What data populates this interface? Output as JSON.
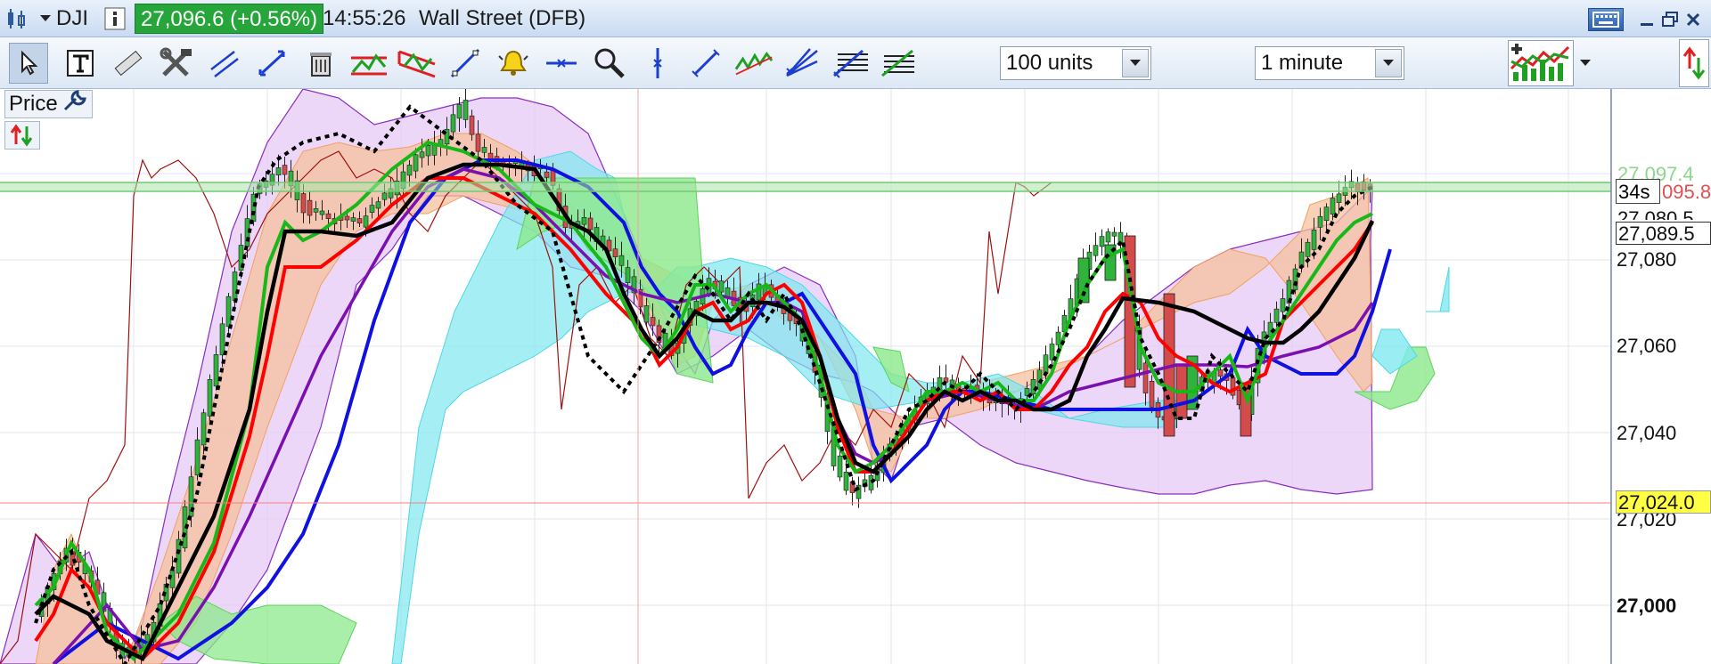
{
  "titlebar": {
    "symbol": "DJI",
    "info_icon": "info-icon",
    "price_badge": "27,096.6 (+0.56%)",
    "time": "14:55:26",
    "market": "Wall Street (DFB)"
  },
  "toolbar": {
    "units_select": "100 units",
    "interval_select": "1 minute",
    "tools": [
      "pointer-icon",
      "text-icon",
      "ruler-icon",
      "tools-icon",
      "parallel-lines-icon",
      "fibonacci-icon",
      "trash-icon",
      "pattern-icon",
      "channel-icon",
      "trendline-icon",
      "alert-bell-icon",
      "horizontal-line-icon",
      "zoom-icon",
      "vertical-line-icon",
      "segment-icon",
      "wave-icon",
      "fan-icon",
      "retracement-icon",
      "extension-icon"
    ]
  },
  "chart": {
    "price_label": "Price",
    "axis_ticks": [
      {
        "label": "27,080",
        "value": 27080
      },
      {
        "label": "27,060",
        "value": 27060
      },
      {
        "label": "27,040",
        "value": 27040
      },
      {
        "label": "27,020",
        "value": 27020
      },
      {
        "label": "27,000",
        "value": 27000
      }
    ],
    "tags": {
      "ask": "27,097.4",
      "bid": "095.8",
      "timer": "34s",
      "level1": "27,080.5",
      "level2": "27,089.5",
      "level3": "27,024.0"
    },
    "colors": {
      "up_candle": "#2fb33c",
      "down_candle": "#d44b4b",
      "ma_black": "#000000",
      "ma_red": "#ff0000",
      "ma_green": "#17b817",
      "ma_blue": "#1010e0",
      "ma_purple": "#7a10b0",
      "cloud_cyan": "#7fe8f0",
      "cloud_green": "#8ce88c",
      "band_purple": "#e6c9f5",
      "band_orange": "#f6c29e",
      "highlight_yellow": "#ffff44"
    }
  }
}
